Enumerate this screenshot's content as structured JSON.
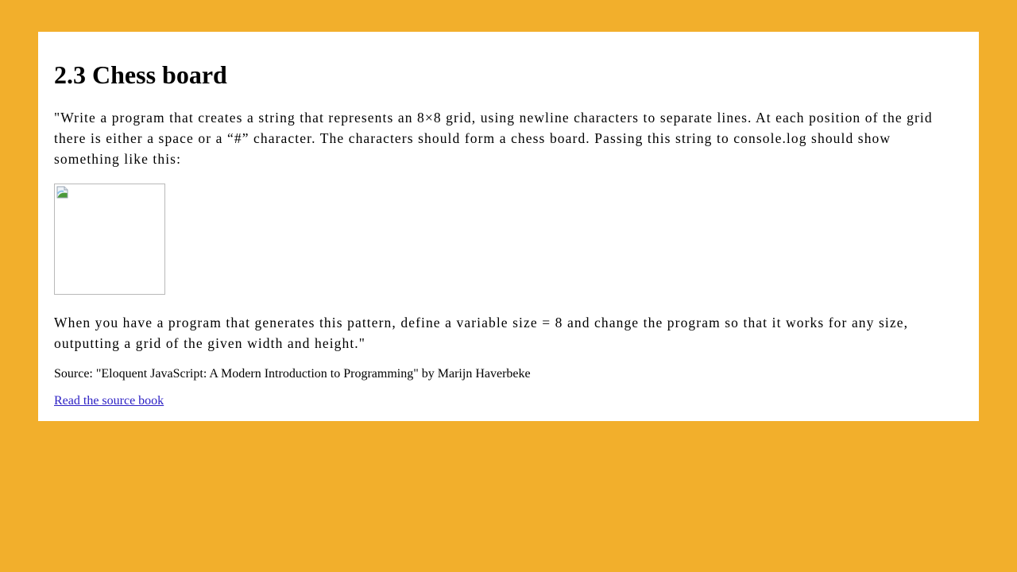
{
  "page": {
    "colors": {
      "background": "#f2af2c",
      "card": "#ffffff",
      "link": "#2b1fc4"
    }
  },
  "article": {
    "title": "2.3 Chess board",
    "intro": "\"Write a program that creates a string that represents an 8×8 grid, using newline characters to separate lines. At each position of the grid there is either a space or a “#” character. The characters should form a chess board. Passing this string to console.log should show something like this:",
    "image": {
      "icon": "broken-image-icon",
      "alt": ""
    },
    "followup": "When you have a program that generates this pattern, define a variable size = 8 and change the program so that it works for any size, outputting a grid of the given width and height.\"",
    "source": "Source: \"Eloquent JavaScript: A Modern Introduction to Programming\" by Marijn Haverbeke",
    "link_label": "Read the source book"
  }
}
